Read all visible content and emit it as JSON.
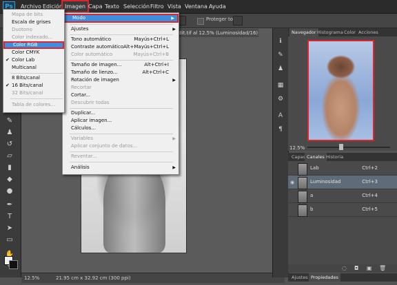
{
  "menubar": {
    "logo": "Ps",
    "items": [
      "Archivo",
      "Edición",
      "Imagen",
      "Capa",
      "Texto",
      "Selección",
      "Filtro",
      "Vista",
      "Ventana",
      "Ayuda"
    ]
  },
  "options_bar": {
    "protect_tones": "Proteger tonos"
  },
  "document": {
    "tab_title": "edit.tif al 12.5% (Luminosidad/16) *",
    "zoom": "12.5%",
    "doc_size": "21.95 cm x 32.92 cm (300 ppi)"
  },
  "imagen_menu": {
    "modo": "Modo",
    "ajustes": "Ajustes",
    "tono_auto": "Tono automático",
    "tono_auto_sc": "Mayús+Ctrl+L",
    "contraste_auto": "Contraste automático",
    "contraste_auto_sc": "Alt+Mayús+Ctrl+L",
    "color_auto": "Color automático",
    "color_auto_sc": "Mayús+Ctrl+B",
    "tam_imagen": "Tamaño de imagen...",
    "tam_imagen_sc": "Alt+Ctrl+I",
    "tam_lienzo": "Tamaño de lienzo...",
    "tam_lienzo_sc": "Alt+Ctrl+C",
    "rotacion": "Rotación de imagen",
    "recortar": "Recortar",
    "cortar": "Cortar...",
    "descubrir": "Descubrir todas",
    "duplicar": "Duplicar...",
    "aplicar_imagen": "Aplicar imagen...",
    "calculos": "Cálculos...",
    "variables": "Variables",
    "aplicar_conjunto": "Aplicar conjunto de datos...",
    "reventar": "Reventar...",
    "analisis": "Análisis"
  },
  "modo_menu": {
    "mapa_bits": "Mapa de bits",
    "escala_grises": "Escala de grises",
    "duotono": "Duotono",
    "color_indexado": "Color indexado...",
    "color_rgb": "Color RGB",
    "color_cmyk": "Color CMYK",
    "color_lab": "Color Lab",
    "multicanal": "Multicanal",
    "bits8": "8 Bits/canal",
    "bits16": "16 Bits/canal",
    "bits32": "32 Bits/canal",
    "tabla_colores": "Tabla de colores..."
  },
  "nav_panel": {
    "tabs": [
      "Navegador",
      "Histograma",
      "Color",
      "Acciones"
    ],
    "zoom": "12.5%"
  },
  "channels_panel": {
    "tabs": [
      "Capas",
      "Canales",
      "Historia"
    ],
    "rows": [
      {
        "name": "Lab",
        "shortcut": "Ctrl+2"
      },
      {
        "name": "Luminosidad",
        "shortcut": "Ctrl+3"
      },
      {
        "name": "a",
        "shortcut": "Ctrl+4"
      },
      {
        "name": "b",
        "shortcut": "Ctrl+5"
      }
    ]
  },
  "bottom_tabs": [
    "Ajustes",
    "Propiedades"
  ]
}
